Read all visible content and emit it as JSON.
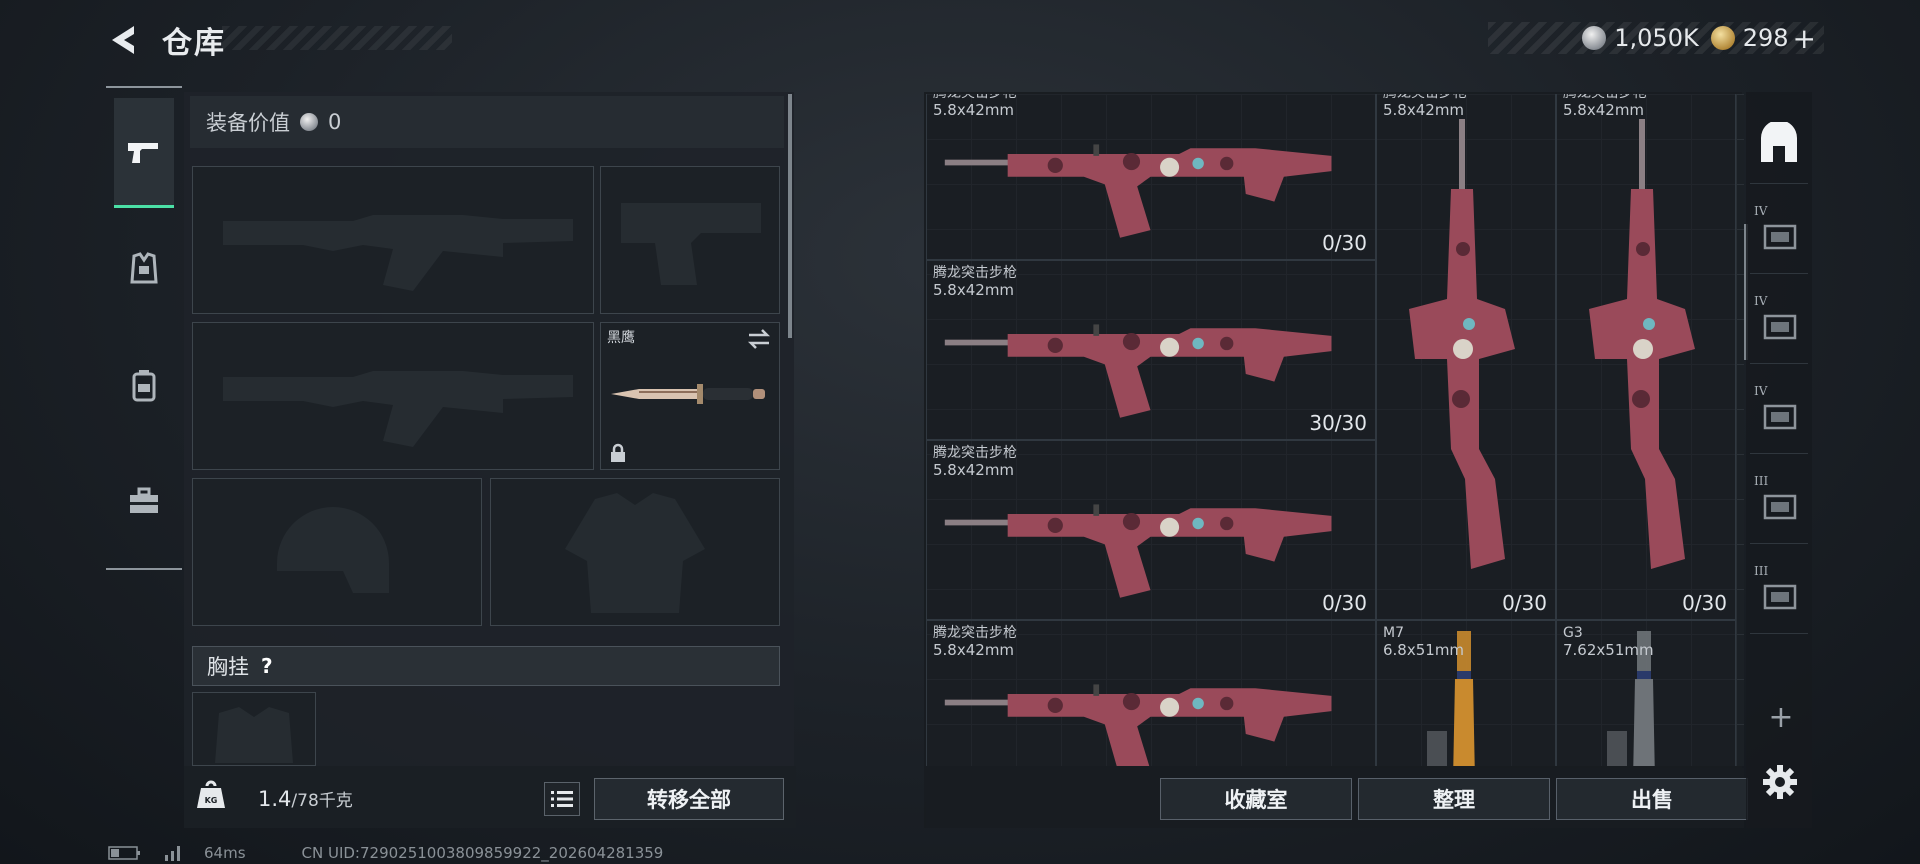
{
  "header": {
    "title": "仓库",
    "currencies": [
      {
        "type": "silver",
        "icon": "silver-coin-icon",
        "amount": "1,050K"
      },
      {
        "type": "gold",
        "icon": "gold-coin-icon",
        "amount": "298"
      }
    ],
    "plus": "+"
  },
  "categories": [
    {
      "id": "weapons",
      "icon": "pistol-icon",
      "active": true
    },
    {
      "id": "armor",
      "icon": "armor-vest-icon",
      "active": false
    },
    {
      "id": "backpack",
      "icon": "backpack-icon",
      "active": false
    },
    {
      "id": "toolkit",
      "icon": "toolbox-icon",
      "active": false
    }
  ],
  "equipment": {
    "value_label": "装备价值",
    "value": "0",
    "knife_name": "黑鹰",
    "chest_label": "胸挂",
    "chest_help": "?",
    "weight_current": "1.4",
    "weight_max": "/78千克",
    "transfer_all": "转移全部"
  },
  "storage": {
    "items": [
      {
        "name": "腾龙突击步枪",
        "caliber": "5.8x42mm",
        "ammo": "0/30"
      },
      {
        "name": "腾龙突击步枪",
        "caliber": "5.8x42mm",
        "ammo": "30/30"
      },
      {
        "name": "腾龙突击步枪",
        "caliber": "5.8x42mm",
        "ammo": "0/30"
      },
      {
        "name": "腾龙突击步枪",
        "caliber": "5.8x42mm",
        "ammo": ""
      },
      {
        "name": "腾龙突击步枪",
        "caliber": "5.8x42mm",
        "ammo": "0/30"
      },
      {
        "name": "腾龙突击步枪",
        "caliber": "5.8x42mm",
        "ammo": "0/30"
      },
      {
        "name": "M7",
        "caliber": "6.8x51mm",
        "ammo": ""
      },
      {
        "name": "G3",
        "caliber": "7.62x51mm",
        "ammo": ""
      }
    ],
    "buttons": {
      "collection": "收藏室",
      "sort": "整理",
      "sell": "出售"
    }
  },
  "storage_tabs": [
    {
      "icon": "home-storage-icon",
      "tier": ""
    },
    {
      "icon": "case-icon",
      "tier": "IV"
    },
    {
      "icon": "case-add-icon",
      "tier": "IV"
    },
    {
      "icon": "folder-icon",
      "tier": "IV"
    },
    {
      "icon": "case-icon",
      "tier": "III"
    },
    {
      "icon": "case-warning-icon",
      "tier": "III"
    }
  ],
  "add_tab": "+",
  "status": {
    "ping": "64ms",
    "uid": "CN UID:7290251003809859922_202604281359"
  },
  "colors": {
    "accent": "#4be0a6",
    "camo": "#9a4a5a"
  }
}
